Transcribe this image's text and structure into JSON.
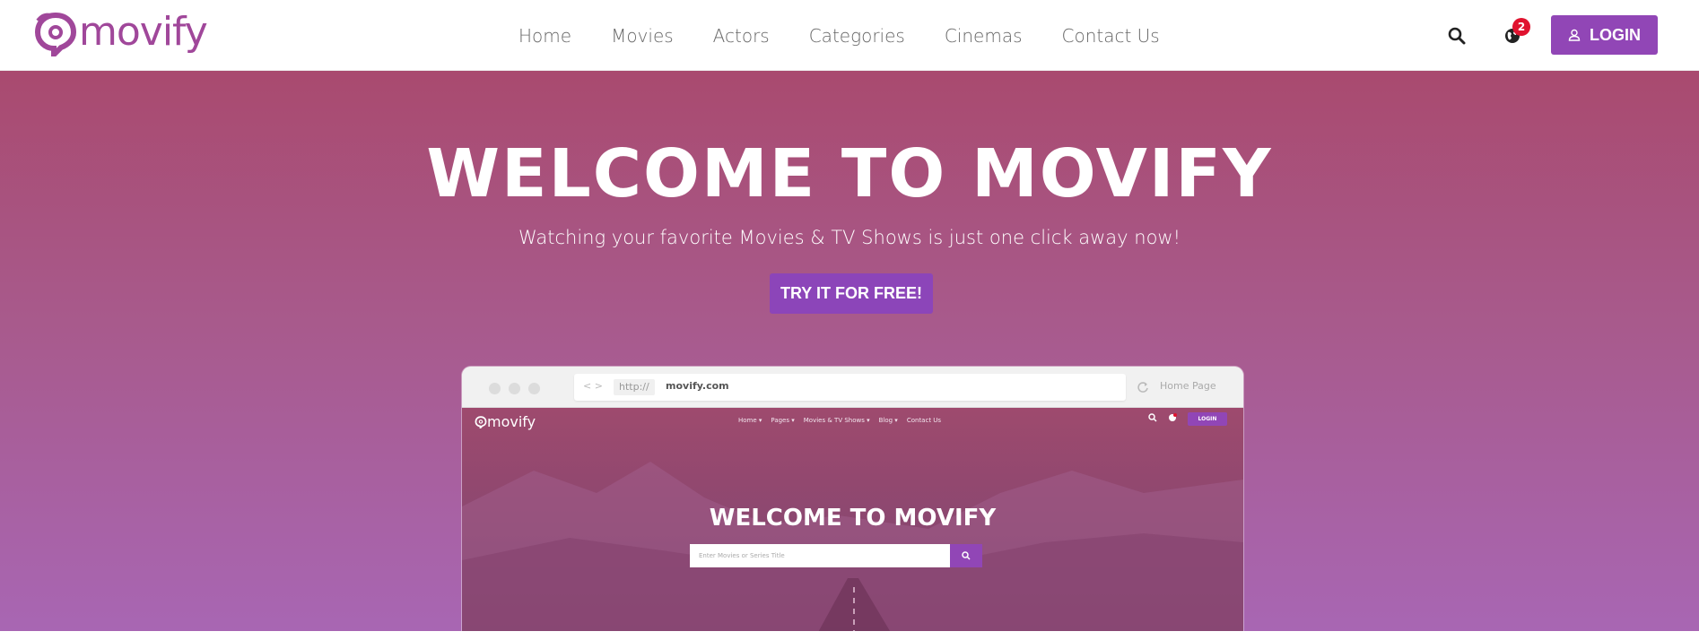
{
  "brand": {
    "name": "movify",
    "color": "#a0479a"
  },
  "nav": {
    "items": [
      {
        "label": "Home"
      },
      {
        "label": "Movies"
      },
      {
        "label": "Actors"
      },
      {
        "label": "Categories"
      },
      {
        "label": "Cinemas"
      },
      {
        "label": "Contact Us"
      }
    ]
  },
  "header": {
    "search_icon": "search-icon",
    "globe_icon": "globe-icon",
    "notification_count": "2",
    "login_label": "LOGIN"
  },
  "hero": {
    "title": "WELCOME TO MOVIFY",
    "subtitle": "Watching your favorite Movies & TV Shows is just one click away now!",
    "cta_label": "TRY IT FOR FREE!"
  },
  "mock_browser": {
    "protocol": "http://",
    "url": "movify.com",
    "home_label": "Home Page",
    "site": {
      "logo": "movify",
      "nav": [
        "Home ▾",
        "Pages ▾",
        "Movies & TV Shows ▾",
        "Blog ▾",
        "Contact Us"
      ],
      "login_label": "LOGIN",
      "title": "WELCOME TO MOVIFY",
      "search_placeholder": "Enter Movies or Series Title"
    }
  },
  "colors": {
    "accent": "#9146b6",
    "badge": "#e0132f",
    "hero_top": "#a94a6f",
    "hero_bottom": "#a866b3"
  }
}
